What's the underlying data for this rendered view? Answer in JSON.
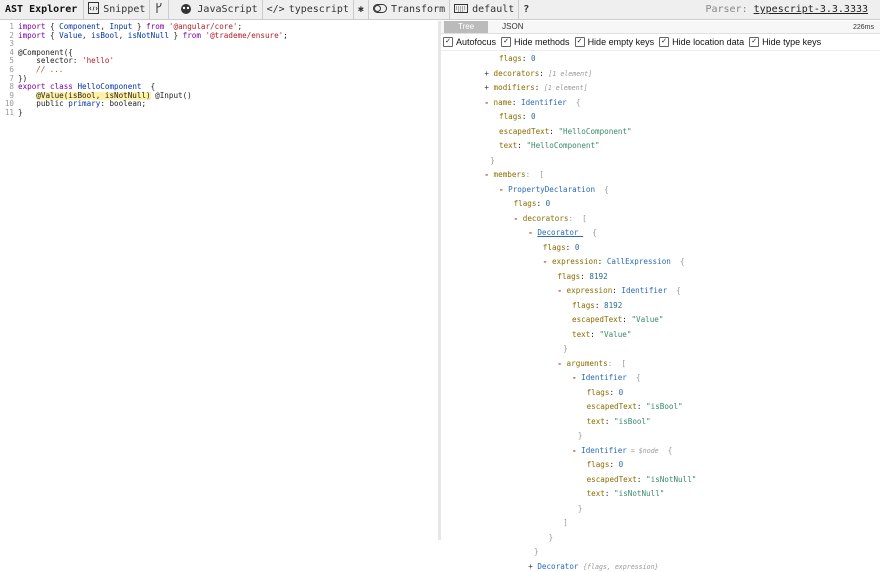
{
  "toolbar": {
    "brand": "AST Explorer",
    "snippet": "Snippet",
    "language": "JavaScript",
    "parser_name": "typescript",
    "transform": "Transform",
    "keymap": "default",
    "help": "?",
    "parser_label": "Parser:",
    "parser_version": "typescript-3.3.3333"
  },
  "editor": {
    "lines": [
      {
        "n": "1",
        "parts": [
          {
            "t": "import",
            "c": "kw"
          },
          {
            "t": " { "
          },
          {
            "t": "Component",
            "c": "id"
          },
          {
            "t": ", "
          },
          {
            "t": "Input",
            "c": "id"
          },
          {
            "t": " } "
          },
          {
            "t": "from",
            "c": "kw"
          },
          {
            "t": " "
          },
          {
            "t": "'@angular/core'",
            "c": "str"
          },
          {
            "t": ";"
          }
        ]
      },
      {
        "n": "2",
        "parts": [
          {
            "t": "import",
            "c": "kw"
          },
          {
            "t": " { "
          },
          {
            "t": "Value",
            "c": "id"
          },
          {
            "t": ", "
          },
          {
            "t": "isBool",
            "c": "id"
          },
          {
            "t": ", "
          },
          {
            "t": "isNotNull",
            "c": "id"
          },
          {
            "t": " } "
          },
          {
            "t": "from",
            "c": "kw"
          },
          {
            "t": " "
          },
          {
            "t": "'@trademe/ensure'",
            "c": "str"
          },
          {
            "t": ";"
          }
        ]
      },
      {
        "n": "3",
        "parts": []
      },
      {
        "n": "4",
        "parts": [
          {
            "t": "@Component({"
          }
        ]
      },
      {
        "n": "5",
        "parts": [
          {
            "t": "    selector: "
          },
          {
            "t": "'hello'",
            "c": "str"
          }
        ]
      },
      {
        "n": "6",
        "parts": [
          {
            "t": "    // ...",
            "c": "cmt"
          }
        ]
      },
      {
        "n": "7",
        "parts": [
          {
            "t": "})"
          }
        ]
      },
      {
        "n": "8",
        "parts": [
          {
            "t": "export",
            "c": "kw"
          },
          {
            "t": " "
          },
          {
            "t": "class",
            "c": "kw"
          },
          {
            "t": " "
          },
          {
            "t": "HelloComponent",
            "c": "id"
          },
          {
            "t": "  {"
          }
        ]
      },
      {
        "n": "9",
        "parts": [
          {
            "t": "    "
          },
          {
            "t": "@Value(isBool, isNotNull)",
            "c": "hl"
          },
          {
            "t": " @Input()"
          }
        ]
      },
      {
        "n": "10",
        "parts": [
          {
            "t": "    public "
          },
          {
            "t": "primary",
            "c": "id"
          },
          {
            "t": ": boolean;"
          }
        ]
      },
      {
        "n": "11",
        "parts": [
          {
            "t": "}"
          }
        ]
      }
    ]
  },
  "output": {
    "tabs": [
      "Tree",
      "JSON"
    ],
    "active_tab": "Tree",
    "time": "226ms"
  },
  "options": [
    {
      "label": "Autofocus",
      "checked": true
    },
    {
      "label": "Hide methods",
      "checked": true
    },
    {
      "label": "Hide empty keys",
      "checked": true
    },
    {
      "label": "Hide location data",
      "checked": true
    },
    {
      "label": "Hide type keys",
      "checked": true
    }
  ],
  "tree": [
    {
      "d": 2,
      "parts": [
        {
          "t": "flags",
          "c": "k"
        },
        {
          "t": ": "
        },
        {
          "t": "0",
          "c": "n"
        }
      ]
    },
    {
      "d": 1,
      "parts": [
        {
          "t": "+ ",
          "c": "pl"
        },
        {
          "t": "decorators",
          "c": "k"
        },
        {
          "t": ": "
        },
        {
          "t": "[1 element]",
          "c": "meta"
        }
      ]
    },
    {
      "d": 1,
      "parts": [
        {
          "t": "+ ",
          "c": "pl"
        },
        {
          "t": "modifiers",
          "c": "k"
        },
        {
          "t": ": "
        },
        {
          "t": "[1 element]",
          "c": "meta"
        }
      ]
    },
    {
      "d": 1,
      "parts": [
        {
          "t": "- ",
          "c": "tg"
        },
        {
          "t": "name",
          "c": "k"
        },
        {
          "t": ": "
        },
        {
          "t": "Identifier",
          "c": "ty"
        },
        {
          "t": "  {",
          "c": "p"
        }
      ]
    },
    {
      "d": 2,
      "parts": [
        {
          "t": "flags",
          "c": "k"
        },
        {
          "t": ": "
        },
        {
          "t": "0",
          "c": "n"
        }
      ]
    },
    {
      "d": 2,
      "parts": [
        {
          "t": "escapedText",
          "c": "k"
        },
        {
          "t": ": "
        },
        {
          "t": "\"HelloComponent\"",
          "c": "s"
        }
      ]
    },
    {
      "d": 2,
      "parts": [
        {
          "t": "text",
          "c": "k"
        },
        {
          "t": ": "
        },
        {
          "t": "\"HelloComponent\"",
          "c": "s"
        }
      ]
    },
    {
      "d": 1.4,
      "parts": [
        {
          "t": "}",
          "c": "p"
        }
      ]
    },
    {
      "d": 1,
      "parts": [
        {
          "t": "- ",
          "c": "tg"
        },
        {
          "t": "members",
          "c": "k"
        },
        {
          "t": ":  [",
          "c": "p"
        }
      ]
    },
    {
      "d": 2,
      "parts": [
        {
          "t": "- ",
          "c": "tg"
        },
        {
          "t": "PropertyDeclaration",
          "c": "ty"
        },
        {
          "t": "  {",
          "c": "p"
        }
      ]
    },
    {
      "d": 3,
      "parts": [
        {
          "t": "flags",
          "c": "k"
        },
        {
          "t": ": "
        },
        {
          "t": "0",
          "c": "n"
        }
      ]
    },
    {
      "d": 3,
      "parts": [
        {
          "t": "- ",
          "c": "tg"
        },
        {
          "t": "decorators",
          "c": "k"
        },
        {
          "t": ":  [",
          "c": "p"
        }
      ]
    },
    {
      "d": 4,
      "parts": [
        {
          "t": "- ",
          "c": "tg"
        },
        {
          "t": "Decorator ",
          "c": "link"
        },
        {
          "t": "  {",
          "c": "p"
        }
      ]
    },
    {
      "d": 5,
      "parts": [
        {
          "t": "flags",
          "c": "k"
        },
        {
          "t": ": "
        },
        {
          "t": "0",
          "c": "n"
        }
      ]
    },
    {
      "d": 5,
      "parts": [
        {
          "t": "- ",
          "c": "tg"
        },
        {
          "t": "expression",
          "c": "k"
        },
        {
          "t": ": "
        },
        {
          "t": "CallExpression",
          "c": "ty"
        },
        {
          "t": "  {",
          "c": "p"
        }
      ]
    },
    {
      "d": 6,
      "parts": [
        {
          "t": "flags",
          "c": "k"
        },
        {
          "t": ": "
        },
        {
          "t": "8192",
          "c": "n"
        }
      ]
    },
    {
      "d": 6,
      "parts": [
        {
          "t": "- ",
          "c": "tg"
        },
        {
          "t": "expression",
          "c": "k"
        },
        {
          "t": ": "
        },
        {
          "t": "Identifier",
          "c": "ty"
        },
        {
          "t": "  {",
          "c": "p"
        }
      ]
    },
    {
      "d": 7,
      "parts": [
        {
          "t": "flags",
          "c": "k"
        },
        {
          "t": ": "
        },
        {
          "t": "8192",
          "c": "n"
        }
      ]
    },
    {
      "d": 7,
      "parts": [
        {
          "t": "escapedText",
          "c": "k"
        },
        {
          "t": ": "
        },
        {
          "t": "\"Value\"",
          "c": "s"
        }
      ]
    },
    {
      "d": 7,
      "parts": [
        {
          "t": "text",
          "c": "k"
        },
        {
          "t": ": "
        },
        {
          "t": "\"Value\"",
          "c": "s"
        }
      ]
    },
    {
      "d": 6.4,
      "parts": [
        {
          "t": "}",
          "c": "p"
        }
      ]
    },
    {
      "d": 6,
      "parts": [
        {
          "t": "- ",
          "c": "tg"
        },
        {
          "t": "arguments",
          "c": "k"
        },
        {
          "t": ":  [",
          "c": "p"
        }
      ]
    },
    {
      "d": 7,
      "parts": [
        {
          "t": "- ",
          "c": "tg"
        },
        {
          "t": "Identifier",
          "c": "ty"
        },
        {
          "t": "  {",
          "c": "p"
        }
      ]
    },
    {
      "d": 8,
      "parts": [
        {
          "t": "flags",
          "c": "k"
        },
        {
          "t": ": "
        },
        {
          "t": "0",
          "c": "n"
        }
      ]
    },
    {
      "d": 8,
      "parts": [
        {
          "t": "escapedText",
          "c": "k"
        },
        {
          "t": ": "
        },
        {
          "t": "\"isBool\"",
          "c": "s"
        }
      ]
    },
    {
      "d": 8,
      "parts": [
        {
          "t": "text",
          "c": "k"
        },
        {
          "t": ": "
        },
        {
          "t": "\"isBool\"",
          "c": "s"
        }
      ]
    },
    {
      "d": 7.4,
      "parts": [
        {
          "t": "}",
          "c": "p"
        }
      ]
    },
    {
      "d": 7,
      "parts": [
        {
          "t": "- ",
          "c": "tg"
        },
        {
          "t": "Identifier",
          "c": "ty"
        },
        {
          "t": " = $node",
          "c": "meta"
        },
        {
          "t": "  {",
          "c": "p"
        }
      ]
    },
    {
      "d": 8,
      "parts": [
        {
          "t": "flags",
          "c": "k"
        },
        {
          "t": ": "
        },
        {
          "t": "0",
          "c": "n"
        }
      ]
    },
    {
      "d": 8,
      "parts": [
        {
          "t": "escapedText",
          "c": "k"
        },
        {
          "t": ": "
        },
        {
          "t": "\"isNotNull\"",
          "c": "s"
        }
      ]
    },
    {
      "d": 8,
      "parts": [
        {
          "t": "text",
          "c": "k"
        },
        {
          "t": ": "
        },
        {
          "t": "\"isNotNull\"",
          "c": "s"
        }
      ]
    },
    {
      "d": 7.4,
      "parts": [
        {
          "t": "}",
          "c": "p"
        }
      ]
    },
    {
      "d": 6.4,
      "parts": [
        {
          "t": "]",
          "c": "p"
        }
      ]
    },
    {
      "d": 5.4,
      "parts": [
        {
          "t": "}",
          "c": "p"
        }
      ]
    },
    {
      "d": 4.4,
      "parts": [
        {
          "t": "}",
          "c": "p"
        }
      ]
    },
    {
      "d": 4,
      "parts": [
        {
          "t": "+ ",
          "c": "pl"
        },
        {
          "t": "Decorator",
          "c": "ty"
        },
        {
          "t": " "
        },
        {
          "t": "{flags, expression}",
          "c": "meta"
        }
      ]
    }
  ]
}
